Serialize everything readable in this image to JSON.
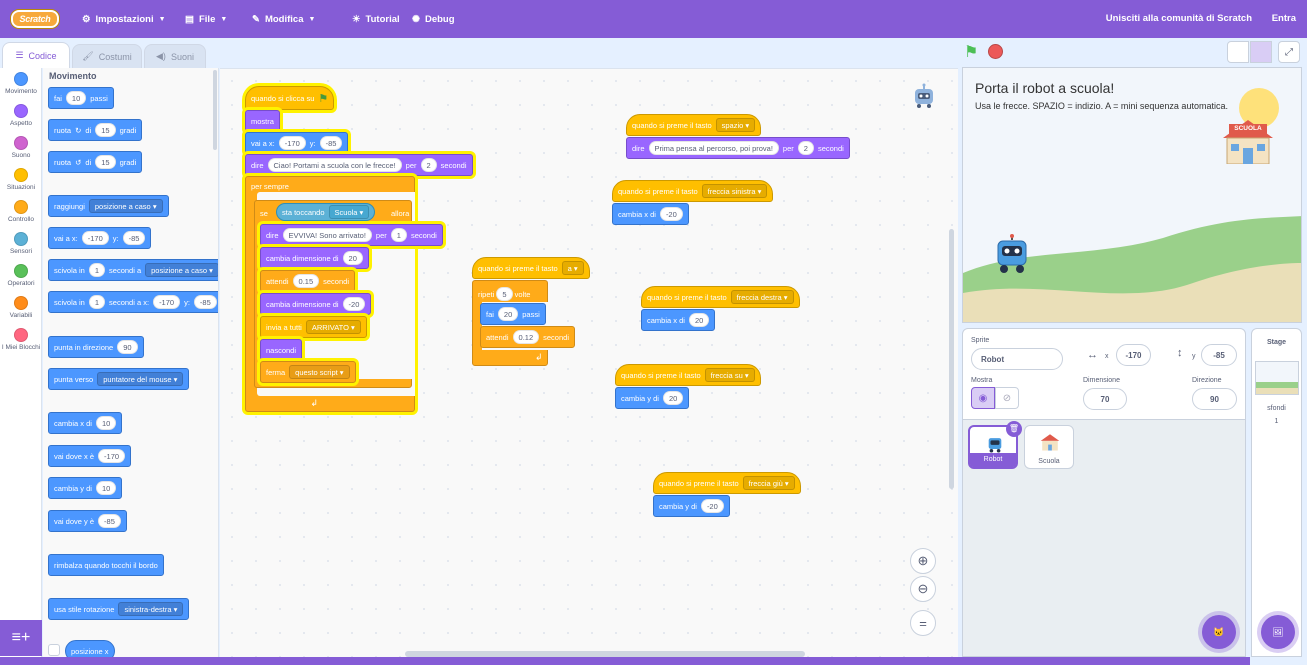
{
  "menu": {
    "logo": "Scratch",
    "settings": "Impostazioni",
    "file": "File",
    "edit": "Modifica",
    "tutorial": "Tutorial",
    "debug": "Debug",
    "join": "Unisciti alla comunità di Scratch",
    "signin": "Entra"
  },
  "tabs": {
    "code": "Codice",
    "costumes": "Costumi",
    "sounds": "Suoni"
  },
  "categories": [
    "Movimento",
    "Aspetto",
    "Suono",
    "Situazioni",
    "Controllo",
    "Sensori",
    "Operatori",
    "Variabili",
    "I Miei Blocchi"
  ],
  "category_colors": [
    "#4c97ff",
    "#9966ff",
    "#cf63cf",
    "#ffbf00",
    "#ffab19",
    "#5cb1d6",
    "#59c059",
    "#ff8c1a",
    "#ff6680"
  ],
  "palette": {
    "title": "Movimento",
    "move": "fai",
    "move_n": "10",
    "move_steps": "passi",
    "turn": "ruota",
    "turn_of": "di",
    "turn_n": "15",
    "degrees": "gradi",
    "goto": "raggiungi",
    "goto_target": "posizione a caso",
    "gotoxy": "vai a x:",
    "gotoxy_x": "-170",
    "y_label": "y:",
    "gotoxy_y": "-85",
    "glide": "scivola in",
    "glide_n": "1",
    "glide_secs_to": "secondi a",
    "glide_target": "posizione a caso",
    "glidexy_secs": "secondi a x:",
    "glidexy_x": "-170",
    "glidexy_y": "-85",
    "point_dir": "punta in direzione",
    "point_dir_n": "90",
    "point_towards": "punta verso",
    "point_towards_target": "puntatore del mouse",
    "change_x": "cambia x di",
    "change_x_n": "10",
    "set_x": "vai dove x è",
    "set_x_n": "-170",
    "change_y": "cambia y di",
    "change_y_n": "10",
    "set_y": "vai dove y è",
    "set_y_n": "-85",
    "bounce": "rimbalza quando tocchi il bordo",
    "rot_style": "usa stile rotazione",
    "rot_style_val": "sinistra-destra",
    "xpos": "posizione x"
  },
  "scripts": {
    "main": {
      "hat": "quando si clicca su",
      "show": "mostra",
      "goto": "vai a x:",
      "x": "-170",
      "y_label": "y:",
      "y": "-85",
      "say": "dire",
      "say_text": "Ciao! Portami a scuola con le frecce!",
      "for": "per",
      "say_secs": "2",
      "secs": "secondi",
      "forever": "per sempre",
      "if": "se",
      "touching": "sta toccando",
      "touching_target": "Scuola",
      "then": "allora",
      "say2_text": "EVVIVA! Sono arrivato!",
      "say2_secs": "1",
      "change_size": "cambia dimensione di",
      "size1": "20",
      "wait": "attendi",
      "wait_n": "0.15",
      "size2": "-20",
      "broadcast": "invia a tutti",
      "broadcast_msg": "ARRIVATO",
      "hide": "nascondi",
      "stop": "ferma",
      "stop_opt": "questo script"
    },
    "space": {
      "hat": "quando si preme il tasto",
      "key": "spazio",
      "say": "dire",
      "text": "Prima pensa al percorso, poi prova!",
      "for": "per",
      "secs_n": "2",
      "secs": "secondi"
    },
    "right_top": {
      "hat": "quando si preme il tasto",
      "key": "freccia sinistra",
      "action": "cambia x di",
      "n": "-20"
    },
    "a_key": {
      "hat": "quando si preme il tasto",
      "key": "a",
      "repeat": "ripeti",
      "repeat_n": "5",
      "times": "volte",
      "move": "fai",
      "move_n": "20",
      "steps": "passi",
      "wait": "attendi",
      "wait_n": "0.12",
      "secs": "secondi"
    },
    "right": {
      "hat": "quando si preme il tasto",
      "key": "freccia destra",
      "action": "cambia x di",
      "n": "20"
    },
    "up": {
      "hat": "quando si preme il tasto",
      "key": "freccia su",
      "action": "cambia y di",
      "n": "20"
    },
    "down": {
      "hat": "quando si preme il tasto",
      "key": "freccia giù",
      "action": "cambia y di",
      "n": "-20"
    }
  },
  "stage": {
    "title": "Porta il robot a scuola!",
    "subtitle": "Usa le frecce. SPAZIO = indizio. A = mini sequenza automatica.",
    "school_label": "SCUOLA"
  },
  "sprite_info": {
    "sprite_label": "Sprite",
    "sprite_name": "Robot",
    "x_label": "x",
    "x": "-170",
    "y_label": "y",
    "y": "-85",
    "show_label": "Mostra",
    "size_label": "Dimensione",
    "size": "70",
    "dir_label": "Direzione",
    "dir": "90"
  },
  "sprites": [
    {
      "name": "Robot"
    },
    {
      "name": "Scuola"
    }
  ],
  "stage_pane": {
    "title": "Stage",
    "backdrops_label": "sfondi",
    "backdrops_n": "1"
  }
}
